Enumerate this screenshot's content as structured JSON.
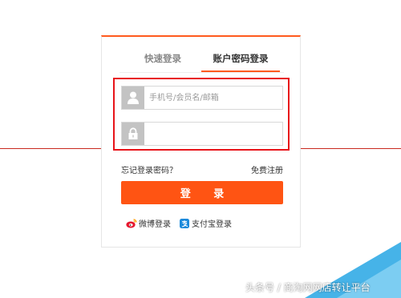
{
  "colors": {
    "accent": "#ff5413",
    "highlight_box": "#e8141a",
    "guide_line": "#c8281e",
    "icon_bg": "#c3c3c3"
  },
  "tabs": [
    {
      "label": "快速登录",
      "active": false
    },
    {
      "label": "账户密码登录",
      "active": true
    }
  ],
  "username": {
    "icon": "user-icon",
    "placeholder": "手机号/会员名/邮箱",
    "value": ""
  },
  "password": {
    "icon": "lock-icon",
    "placeholder": "",
    "value": ""
  },
  "links": {
    "forgot_password": "忘记登录密码？",
    "register": "免费注册"
  },
  "login_button": "登 录",
  "third_party": [
    {
      "icon": "weibo-icon",
      "label": "微博登录"
    },
    {
      "icon": "alipay-icon",
      "label": "支付宝登录"
    }
  ],
  "watermark": "头条号 / 商淘网网店转让平台"
}
